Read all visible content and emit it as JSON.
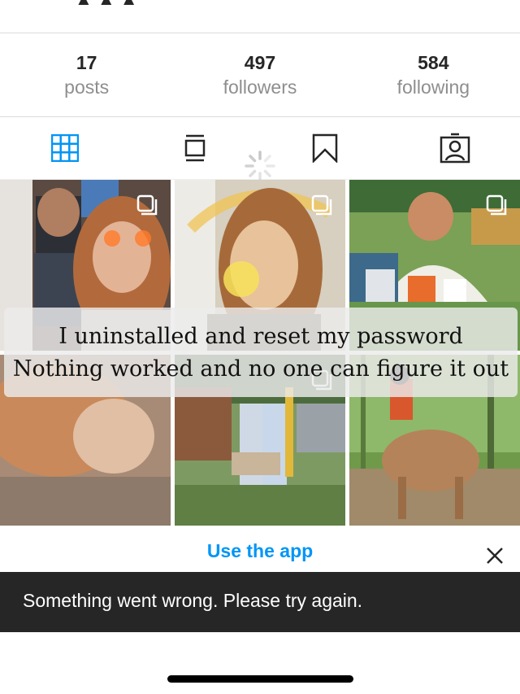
{
  "profile": {
    "stats": [
      {
        "value": "17",
        "label": "posts"
      },
      {
        "value": "497",
        "label": "followers"
      },
      {
        "value": "584",
        "label": "following"
      }
    ]
  },
  "tabs": [
    {
      "name": "grid",
      "icon": "grid-icon",
      "active": true
    },
    {
      "name": "feed",
      "icon": "feed-icon"
    },
    {
      "name": "saved",
      "icon": "bookmark-icon"
    },
    {
      "name": "tagged",
      "icon": "tagged-icon"
    }
  ],
  "caption": {
    "line1": "I uninstalled and reset my password",
    "line2": "Nothing worked and no one can figure it out"
  },
  "banner": {
    "link_label": "Use the app",
    "close_icon": "close-icon"
  },
  "toast": {
    "message": "Something went wrong. Please try again."
  },
  "colors": {
    "accent": "#0095f6",
    "toast_bg": "#262626",
    "muted": "#8e8e8e"
  }
}
